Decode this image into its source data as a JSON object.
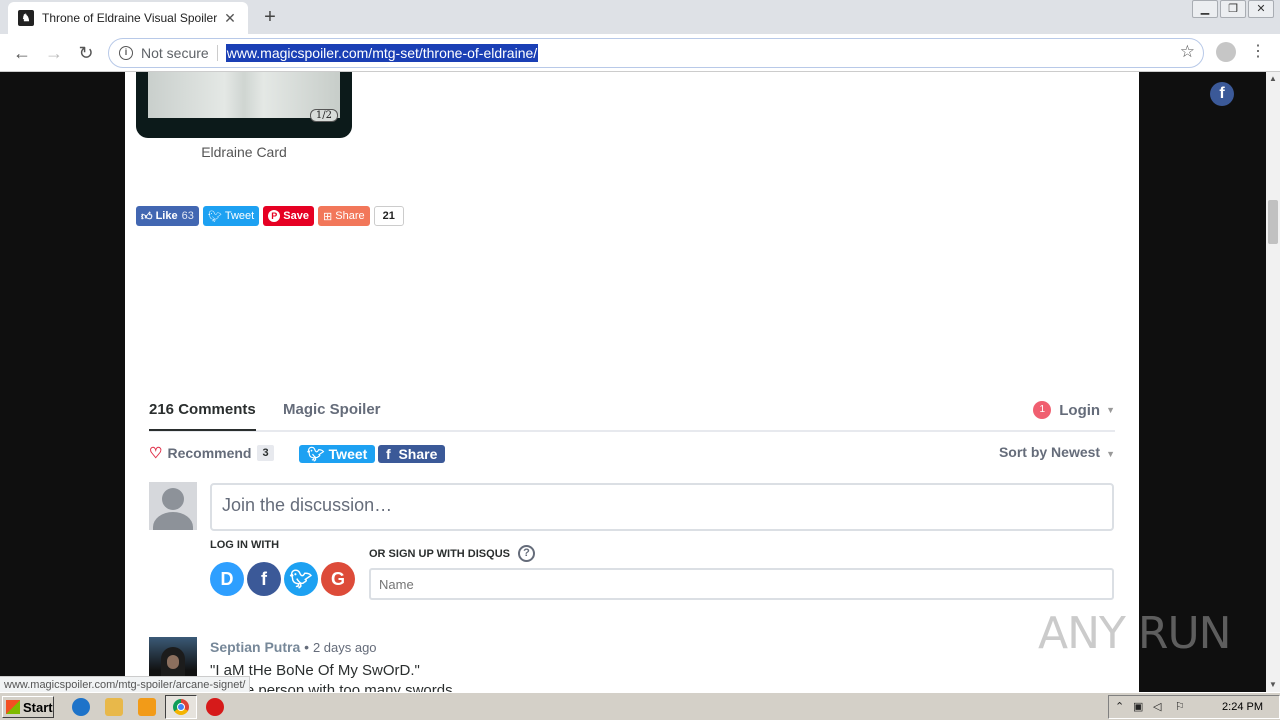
{
  "browser": {
    "tab_title": "Throne of Eldraine Visual Spoiler",
    "tab_close": "✕",
    "new_tab": "+",
    "not_secure": "Not secure",
    "url": "www.magicspoiler.com/mtg-set/throne-of-eldraine/",
    "status_url": "www.magicspoiler.com/mtg-spoiler/arcane-signet/"
  },
  "page": {
    "card_number": "1/2",
    "card_caption": "Eldraine Card",
    "share_bar": {
      "like_label": "Like",
      "like_count": "63",
      "tweet_label": "Tweet",
      "save_label": "Save",
      "share_label": "Share",
      "total_count": "21"
    }
  },
  "disqus": {
    "comments_tab": "216 Comments",
    "site_tab": "Magic Spoiler",
    "login_badge": "1",
    "login_label": "Login",
    "recommend_label": "Recommend",
    "recommend_count": "3",
    "tweet_label": "Tweet",
    "share_label": "Share",
    "sort_label": "Sort by Newest",
    "join_placeholder": "Join the discussion…",
    "log_in_with": "LOG IN WITH",
    "sign_up_with": "OR SIGN UP WITH DISQUS",
    "name_placeholder": "Name",
    "comment": {
      "author": "Septian Putra",
      "separator": "•",
      "time": "2 days ago",
      "line1": "\"I aM tHe BoNe Of My SwOrD.\"",
      "line2": "-Some person with too many swords"
    }
  },
  "taskbar": {
    "start_label": "Start",
    "clock": "2:24 PM"
  },
  "watermark": "ANY RUN",
  "colors": {
    "facebook": "#3b5998",
    "twitter": "#1da1f2",
    "pinterest": "#e60023",
    "disqus": "#2e9fff",
    "google": "#dd4b39",
    "url_highlight": "#1a3fb5"
  }
}
